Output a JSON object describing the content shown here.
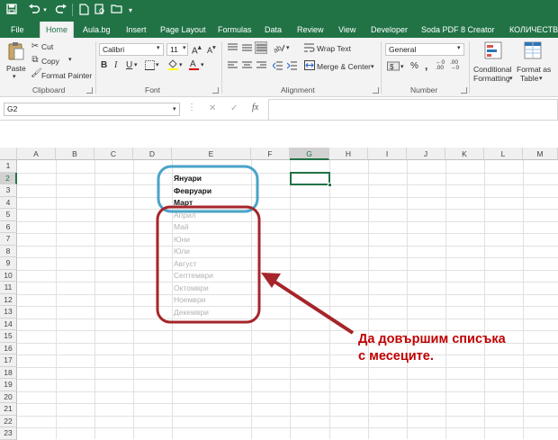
{
  "titlebar": {
    "color": "#217346",
    "redo_icon": "redo-icon"
  },
  "tabs": [
    {
      "label": "File",
      "active": false
    },
    {
      "label": "Home",
      "active": true
    },
    {
      "label": "Aula.bg",
      "active": false
    },
    {
      "label": "Insert",
      "active": false
    },
    {
      "label": "Page Layout",
      "active": false
    },
    {
      "label": "Formulas",
      "active": false
    },
    {
      "label": "Data",
      "active": false
    },
    {
      "label": "Review",
      "active": false
    },
    {
      "label": "View",
      "active": false
    },
    {
      "label": "Developer",
      "active": false
    },
    {
      "label": "Soda PDF 8 Creator",
      "active": false
    },
    {
      "label": "КОЛИЧЕСТВЕНИ",
      "active": false
    }
  ],
  "ribbon": {
    "clipboard": {
      "paste": "Paste",
      "cut": "Cut",
      "copy": "Copy",
      "format_painter": "Format Painter",
      "label": "Clipboard"
    },
    "font": {
      "name": "Calibri",
      "size": "11",
      "bold": "B",
      "italic": "I",
      "underline": "U",
      "label": "Font"
    },
    "alignment": {
      "wrap_text": "Wrap Text",
      "merge_center": "Merge & Center",
      "label": "Alignment"
    },
    "number": {
      "format": "General",
      "label": "Number"
    },
    "styles": {
      "conditional_1": "Conditional",
      "conditional_2": "Formatting",
      "format_as_1": "Format as",
      "format_as_2": "Table"
    }
  },
  "formula_bar": {
    "name_box": "G2",
    "fx": "fx",
    "cancel": "✕",
    "enter": "✓",
    "value": ""
  },
  "columns": [
    "A",
    "B",
    "C",
    "D",
    "E",
    "F",
    "G",
    "H",
    "I",
    "J",
    "K",
    "L",
    "M"
  ],
  "rows": [
    "1",
    "2",
    "3",
    "4",
    "5",
    "6",
    "7",
    "8",
    "9",
    "10",
    "11",
    "12",
    "13",
    "14",
    "15",
    "16",
    "17",
    "18",
    "19",
    "20",
    "21",
    "22",
    "23"
  ],
  "cells": {
    "entered": [
      "Януари",
      "Февруари",
      "Март"
    ],
    "autofill_preview": [
      "Април",
      "Май",
      "Юни",
      "Юли",
      "Август",
      "Септември",
      "Октомври",
      "Ноември",
      "Декември"
    ]
  },
  "selected_cell": "G2",
  "annotation": {
    "line1": "Да довършим списъка",
    "line2": "с месеците.",
    "color": "#c00000"
  },
  "highlight_colors": {
    "entered": "#4aa3c9",
    "preview": "#a5252a",
    "selection": "#217346"
  }
}
